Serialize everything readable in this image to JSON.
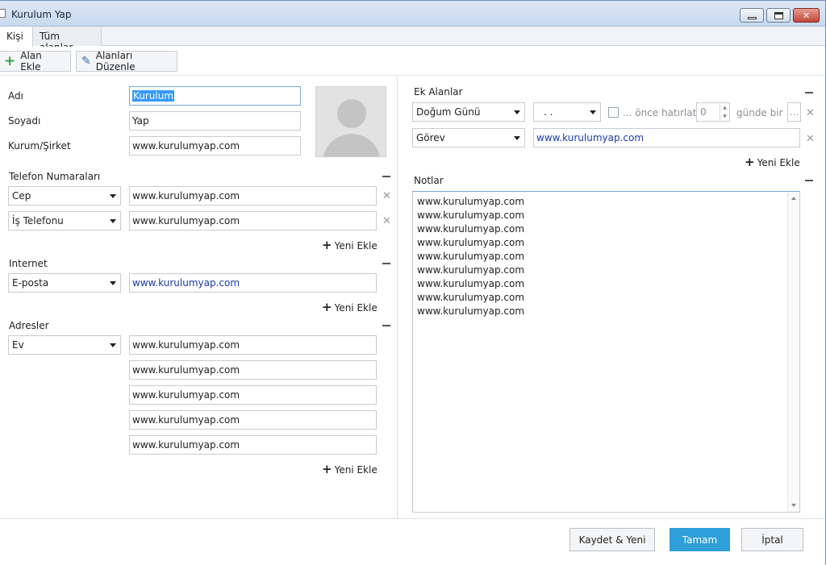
{
  "window": {
    "title": "Kurulum Yap"
  },
  "tabs": [
    {
      "label": "Kişi"
    },
    {
      "label": "Tüm alanlar"
    }
  ],
  "toolbar": {
    "add_field": "Alan Ekle",
    "edit_fields": "Alanları Düzenle"
  },
  "contact": {
    "first_name_label": "Adı",
    "first_name_value": "Kurulum",
    "last_name_label": "Soyadı",
    "last_name_value": "Yap",
    "company_label": "Kurum/Şirket",
    "company_value": "www.kurulumyap.com"
  },
  "phones": {
    "title": "Telefon Numaraları",
    "items": [
      {
        "type": "Cep",
        "value": "www.kurulumyap.com"
      },
      {
        "type": "İş Telefonu",
        "value": "www.kurulumyap.com"
      }
    ],
    "add_new": "Yeni Ekle"
  },
  "internet": {
    "title": "Internet",
    "items": [
      {
        "type": "E-posta",
        "value": "www.kurulumyap.com"
      }
    ],
    "add_new": "Yeni Ekle"
  },
  "addresses": {
    "title": "Adresler",
    "type": "Ev",
    "lines": [
      "www.kurulumyap.com",
      "www.kurulumyap.com",
      "www.kurulumyap.com",
      "www.kurulumyap.com",
      "www.kurulumyap.com"
    ],
    "add_new": "Yeni Ekle"
  },
  "extra_fields": {
    "title": "Ek Alanlar",
    "birthday": {
      "type": "Doğum Günü",
      "date": ". .",
      "remind_label": "... önce hatırlat",
      "days_value": "0",
      "period_label": "günde bir",
      "ellipsis": "..."
    },
    "job": {
      "type": "Görev",
      "value": "www.kurulumyap.com"
    },
    "add_new": "Yeni Ekle"
  },
  "notes": {
    "title": "Notlar",
    "lines": [
      "www.kurulumyap.com",
      "www.kurulumyap.com",
      "www.kurulumyap.com",
      "www.kurulumyap.com",
      "www.kurulumyap.com",
      "www.kurulumyap.com",
      "www.kurulumyap.com",
      "www.kurulumyap.com",
      "www.kurulumyap.com"
    ]
  },
  "footer": {
    "save_new": "Kaydet & Yeni",
    "ok": "Tamam",
    "cancel": "İptal"
  },
  "colors": {
    "primary_button": "#2e9fd8",
    "link_text": "#1a3aa8",
    "selection": "#3399ff"
  }
}
